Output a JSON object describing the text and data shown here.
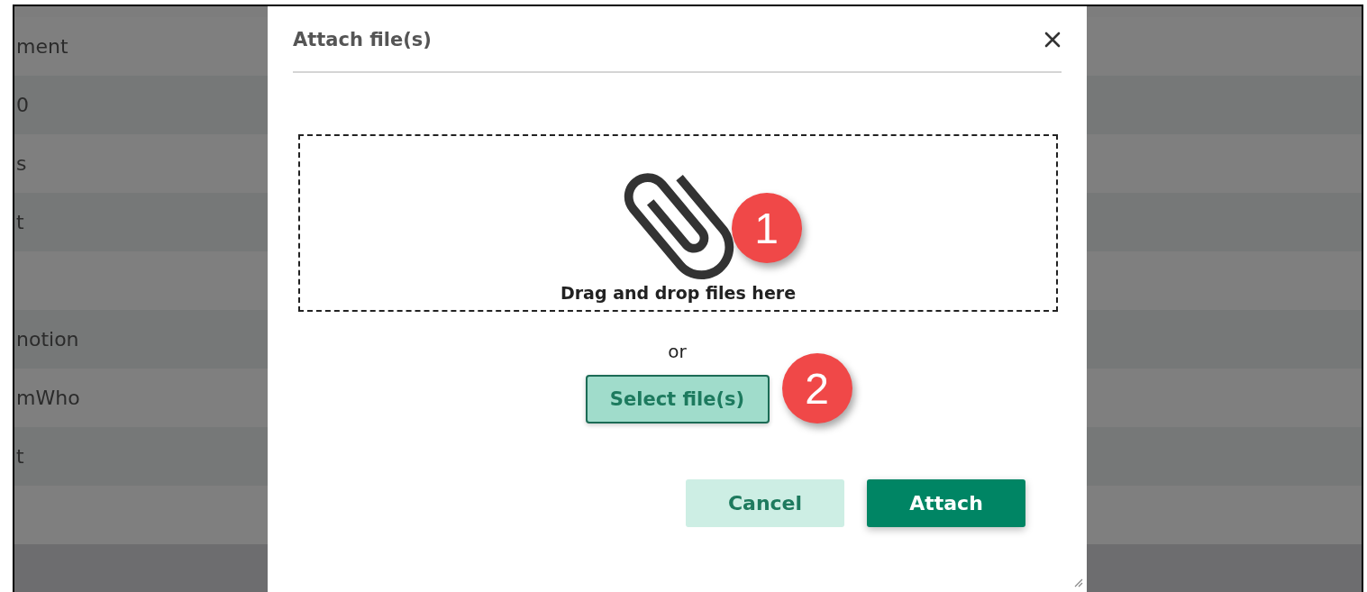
{
  "background_rows": [
    {
      "text": "ment"
    },
    {
      "text": "0"
    },
    {
      "text": "s"
    },
    {
      "text": "t"
    },
    {
      "text": ""
    },
    {
      "text": "notion"
    },
    {
      "text": "mWho"
    },
    {
      "text": "t"
    },
    {
      "text": ""
    }
  ],
  "dialog": {
    "title": "Attach file(s)",
    "dropzone": {
      "label": "Drag and drop files here",
      "callout": "1"
    },
    "separator": "or",
    "select_button": {
      "label": "Select file(s)",
      "callout": "2"
    },
    "buttons": [
      {
        "label": "Cancel",
        "kind": "secondary"
      },
      {
        "label": "Attach",
        "kind": "primary"
      }
    ]
  }
}
